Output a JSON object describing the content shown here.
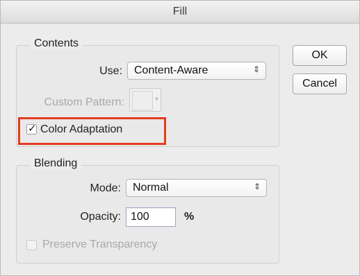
{
  "dialog": {
    "title": "Fill"
  },
  "contents": {
    "group_label": "Contents",
    "use_label": "Use:",
    "use_value": "Content-Aware",
    "custom_pattern_label": "Custom Pattern:",
    "color_adaptation_label": "Color Adaptation",
    "color_adaptation_checked": true
  },
  "blending": {
    "group_label": "Blending",
    "mode_label": "Mode:",
    "mode_value": "Normal",
    "opacity_label": "Opacity:",
    "opacity_value": "100",
    "opacity_unit": "%",
    "preserve_transparency_label": "Preserve Transparency",
    "preserve_transparency_checked": false
  },
  "buttons": {
    "ok": "OK",
    "cancel": "Cancel"
  },
  "icons": {
    "select_arrows": "updown-chevron-icon",
    "checkmark": "checkmark-icon",
    "pattern_caret": "chevron-down-icon"
  },
  "colors": {
    "highlight_border": "#e23b1e",
    "focus_field_border": "#9ca9bd"
  }
}
